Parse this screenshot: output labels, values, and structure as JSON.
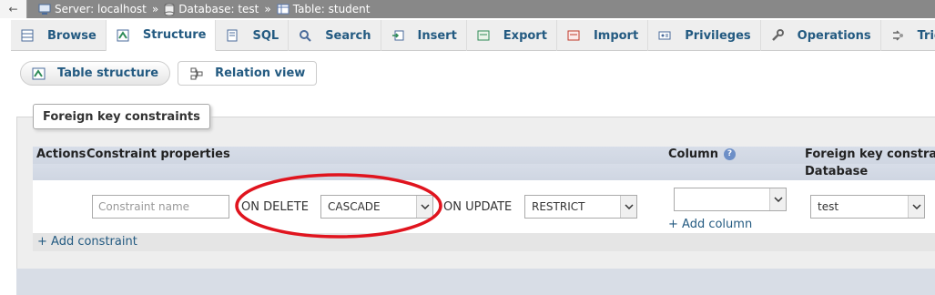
{
  "breadcrumb": {
    "back_label": "←",
    "server": "Server: localhost",
    "database": "Database: test",
    "table": "Table: student",
    "separator": "»"
  },
  "tabs": [
    {
      "label": "Browse",
      "icon": "browse-icon"
    },
    {
      "label": "Structure",
      "icon": "structure-icon",
      "active": true
    },
    {
      "label": "SQL",
      "icon": "sql-icon"
    },
    {
      "label": "Search",
      "icon": "search-icon"
    },
    {
      "label": "Insert",
      "icon": "insert-icon"
    },
    {
      "label": "Export",
      "icon": "export-icon"
    },
    {
      "label": "Import",
      "icon": "import-icon"
    },
    {
      "label": "Privileges",
      "icon": "privileges-icon"
    },
    {
      "label": "Operations",
      "icon": "wrench-icon"
    },
    {
      "label": "Triggers",
      "icon": "triggers-icon"
    }
  ],
  "subtabs": {
    "table_structure": "Table structure",
    "relation_view": "Relation view"
  },
  "fieldset": {
    "legend": "Foreign key constraints"
  },
  "table": {
    "headers": {
      "actions": "Actions",
      "constraint_properties": "Constraint properties",
      "column": "Column",
      "fk_constraint": "Foreign key constraint",
      "database": "Database"
    },
    "row": {
      "constraint_name_placeholder": "Constraint name",
      "on_delete_label": "ON DELETE",
      "on_delete_value": "CASCADE",
      "on_update_label": "ON UPDATE",
      "on_update_value": "RESTRICT",
      "column_value": "",
      "add_column": "+ Add column",
      "database_value": "test"
    },
    "add_constraint": "+ Add constraint"
  },
  "colors": {
    "link": "#235a81",
    "annotation": "#e0141e",
    "tab_bar": "#eeeeee",
    "header_bg": "#d7dde8"
  }
}
